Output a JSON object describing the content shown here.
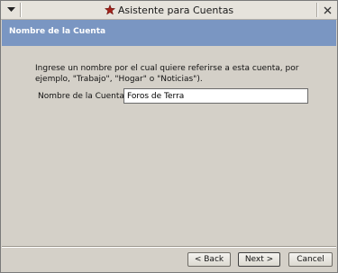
{
  "window": {
    "title": "Asistente para Cuentas",
    "icon": "red-star-icon",
    "menu_icon": "window-menu-icon",
    "close_icon": "close-icon"
  },
  "header": {
    "title": "Nombre de la Cuenta",
    "background": "#7a96c2"
  },
  "form": {
    "instructions": "Ingrese un nombre por el cual quiere referirse a esta cuenta, por ejemplo, \"Trabajo\", \"Hogar\" o \"Noticias\").",
    "field_label": "Nombre de la Cuenta:",
    "field_value": "Foros de Terra"
  },
  "buttons": {
    "back": "< Back",
    "next": "Next >",
    "cancel": "Cancel"
  }
}
